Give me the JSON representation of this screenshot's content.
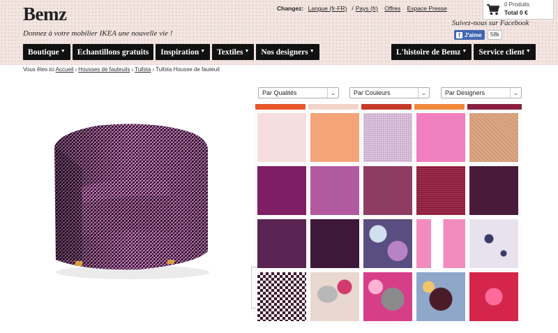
{
  "header": {
    "logo": "Bemz",
    "tagline": "Donnez à votre mobilier IKEA une nouvelle vie !",
    "changez_label": "Changez:",
    "language_link": "Langue (fr-FR)",
    "country_link": "Pays (fr)",
    "offers_link": "Offres",
    "press_link": "Espace Presse",
    "follow_text": "Suivez-nous sur Facebook",
    "fb_like_label": "J'aime",
    "fb_count": "58k"
  },
  "cart": {
    "count_text": "0 Produits",
    "total_text": "Total 0 €",
    "icon": "shopping-cart-icon"
  },
  "nav": {
    "left": [
      {
        "label": "Boutique",
        "dropdown": true
      },
      {
        "label": "Echantillons gratuits",
        "dropdown": false
      },
      {
        "label": "Inspiration",
        "dropdown": true
      },
      {
        "label": "Textiles",
        "dropdown": true
      },
      {
        "label": "Nos designers",
        "dropdown": true
      }
    ],
    "right": [
      {
        "label": "L'histoire de Bemz",
        "dropdown": true
      },
      {
        "label": "Service client",
        "dropdown": true
      }
    ]
  },
  "breadcrumb": {
    "prefix": "Vous êtes ici",
    "items": [
      "Accueil",
      "Housses de fauteuils",
      "Tullsta"
    ],
    "current": "Tullsta Housse de fauteuil"
  },
  "filters": [
    {
      "label": "Par Qualités"
    },
    {
      "label": "Par Couleurs"
    },
    {
      "label": "Par Designers"
    }
  ],
  "colors": {
    "nav_bg": "#111111",
    "header_bg": "#f3e6e2",
    "fabric_primary": "#7a3a6e"
  },
  "swatches": [
    {
      "name": "pale-pink-linen",
      "color": "#f6dede"
    },
    {
      "name": "salmon-orange",
      "color": "#f5a47a"
    },
    {
      "name": "lilac-weave",
      "color": "#c9a6c9"
    },
    {
      "name": "bright-pink",
      "color": "#f07fbf"
    },
    {
      "name": "tan-tweed",
      "color": "#e0a884"
    },
    {
      "name": "plum",
      "color": "#7e1e64"
    },
    {
      "name": "orchid",
      "color": "#b25aa0"
    },
    {
      "name": "mauve",
      "color": "#8f3c62"
    },
    {
      "name": "raspberry-tweed",
      "color": "#8e1d3c"
    },
    {
      "name": "aubergine",
      "color": "#4a1a3a"
    },
    {
      "name": "deep-plum",
      "color": "#5a2452"
    },
    {
      "name": "dark-aubergine",
      "color": "#3d1838"
    },
    {
      "name": "floral-navy",
      "color": "#5a4e80"
    },
    {
      "name": "pink-stripe",
      "color": "#f28cbf"
    },
    {
      "name": "toile-floral",
      "color": "#e8e2ee"
    },
    {
      "name": "houndstooth",
      "color": "#3b1a2c"
    },
    {
      "name": "leaf-print",
      "color": "#e9d8d0"
    },
    {
      "name": "bold-floral-pink",
      "color": "#d63f88"
    },
    {
      "name": "rose-print-blue",
      "color": "#8fa7c9"
    },
    {
      "name": "fuchsia-damask",
      "color": "#d4264a"
    }
  ]
}
